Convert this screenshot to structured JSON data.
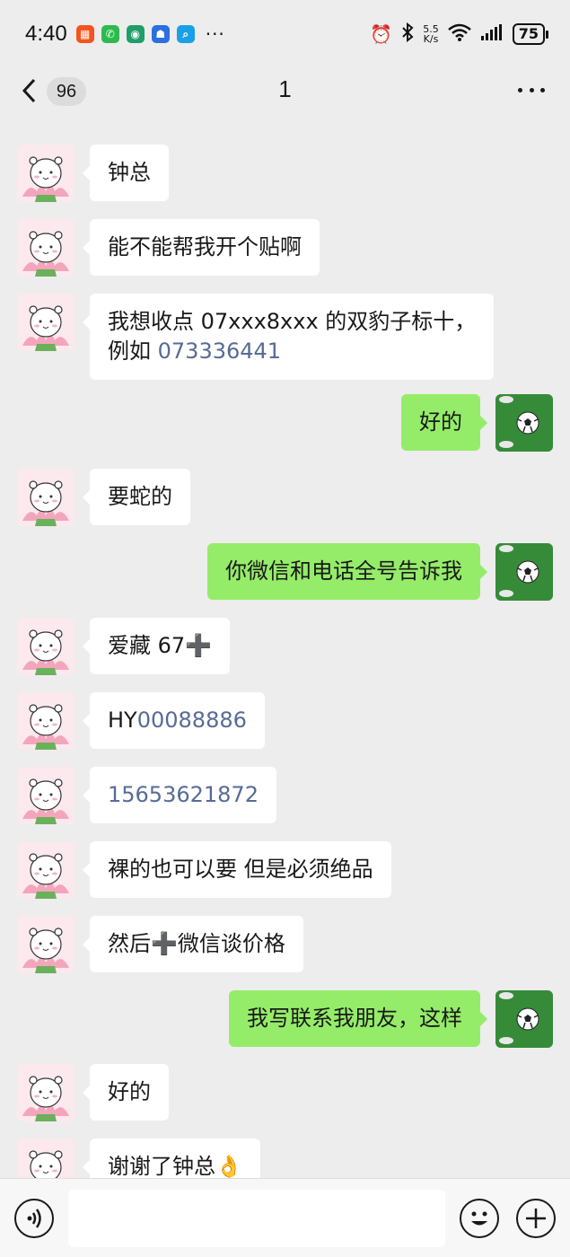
{
  "status_bar": {
    "time": "4:40",
    "network_speed_value": "5.5",
    "network_speed_unit": "K/s",
    "battery": "75",
    "more_icons": "···"
  },
  "header": {
    "back_count": "96",
    "title": "1",
    "more_icon": "more-horizontal-icon"
  },
  "colors": {
    "incoming_bubble": "#ffffff",
    "outgoing_bubble": "#95ec69",
    "link": "#576b95",
    "background": "#ededed"
  },
  "messages": [
    {
      "dir": "in",
      "lines": [
        [
          {
            "t": "钟总"
          }
        ]
      ]
    },
    {
      "dir": "in",
      "lines": [
        [
          {
            "t": "能不能帮我开个贴啊"
          }
        ]
      ]
    },
    {
      "dir": "in",
      "lines": [
        [
          {
            "t": "我想收点 07xxx8xxx 的双豹子标十，"
          }
        ],
        [
          {
            "t": "例如 "
          },
          {
            "t": "073336441",
            "link": true
          }
        ]
      ]
    },
    {
      "dir": "out",
      "lines": [
        [
          {
            "t": "好的"
          }
        ]
      ]
    },
    {
      "dir": "in",
      "lines": [
        [
          {
            "t": "要蛇的"
          }
        ]
      ]
    },
    {
      "dir": "out",
      "lines": [
        [
          {
            "t": "你微信和电话全号告诉我"
          }
        ]
      ]
    },
    {
      "dir": "in",
      "lines": [
        [
          {
            "t": "爱藏 67"
          },
          {
            "t": "➕",
            "glyph": true
          }
        ]
      ]
    },
    {
      "dir": "in",
      "lines": [
        [
          {
            "t": "HY"
          },
          {
            "t": "00088886",
            "link": true
          }
        ]
      ]
    },
    {
      "dir": "in",
      "lines": [
        [
          {
            "t": "15653621872",
            "link": true
          }
        ]
      ]
    },
    {
      "dir": "in",
      "lines": [
        [
          {
            "t": "裸的也可以要 但是必须绝品"
          }
        ]
      ]
    },
    {
      "dir": "in",
      "lines": [
        [
          {
            "t": "然后"
          },
          {
            "t": "➕",
            "glyph": true
          },
          {
            "t": "微信谈价格"
          }
        ]
      ]
    },
    {
      "dir": "out",
      "lines": [
        [
          {
            "t": "我写联系我朋友，这样"
          }
        ]
      ]
    },
    {
      "dir": "in",
      "lines": [
        [
          {
            "t": "好的"
          }
        ]
      ]
    },
    {
      "dir": "in",
      "lines": [
        [
          {
            "t": "谢谢了钟总"
          },
          {
            "t": "👌",
            "glyph": true
          }
        ]
      ]
    }
  ],
  "input": {
    "value": "",
    "placeholder": ""
  }
}
